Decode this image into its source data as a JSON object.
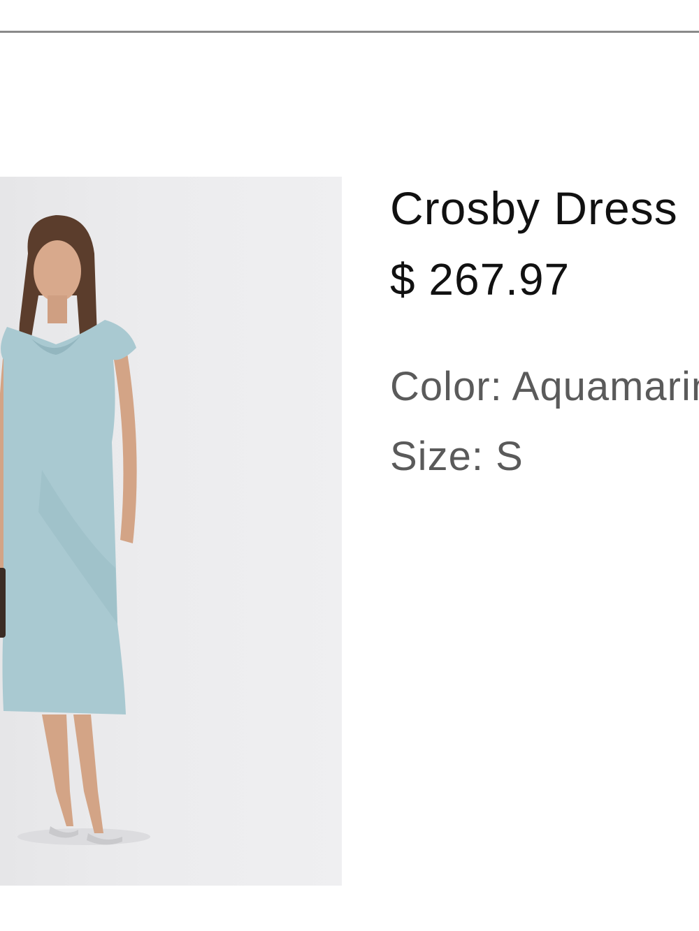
{
  "product": {
    "name": "Crosby Dress",
    "price": "$ 267.97",
    "color_label": "Color:",
    "color_value": "Aquamarine",
    "size_label": "Size:",
    "size_value": "S"
  },
  "image": {
    "icon": "product-photo-icon",
    "dress_color": "#a9c9d1",
    "background_color": "#ececee"
  }
}
